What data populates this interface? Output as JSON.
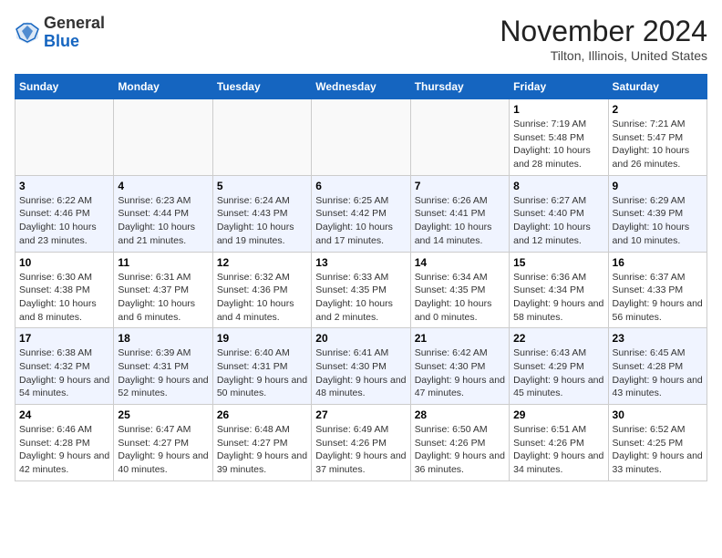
{
  "logo": {
    "general": "General",
    "blue": "Blue"
  },
  "header": {
    "month": "November 2024",
    "location": "Tilton, Illinois, United States"
  },
  "weekdays": [
    "Sunday",
    "Monday",
    "Tuesday",
    "Wednesday",
    "Thursday",
    "Friday",
    "Saturday"
  ],
  "weeks": [
    [
      {
        "day": "",
        "info": ""
      },
      {
        "day": "",
        "info": ""
      },
      {
        "day": "",
        "info": ""
      },
      {
        "day": "",
        "info": ""
      },
      {
        "day": "",
        "info": ""
      },
      {
        "day": "1",
        "info": "Sunrise: 7:19 AM\nSunset: 5:48 PM\nDaylight: 10 hours and 28 minutes."
      },
      {
        "day": "2",
        "info": "Sunrise: 7:21 AM\nSunset: 5:47 PM\nDaylight: 10 hours and 26 minutes."
      }
    ],
    [
      {
        "day": "3",
        "info": "Sunrise: 6:22 AM\nSunset: 4:46 PM\nDaylight: 10 hours and 23 minutes."
      },
      {
        "day": "4",
        "info": "Sunrise: 6:23 AM\nSunset: 4:44 PM\nDaylight: 10 hours and 21 minutes."
      },
      {
        "day": "5",
        "info": "Sunrise: 6:24 AM\nSunset: 4:43 PM\nDaylight: 10 hours and 19 minutes."
      },
      {
        "day": "6",
        "info": "Sunrise: 6:25 AM\nSunset: 4:42 PM\nDaylight: 10 hours and 17 minutes."
      },
      {
        "day": "7",
        "info": "Sunrise: 6:26 AM\nSunset: 4:41 PM\nDaylight: 10 hours and 14 minutes."
      },
      {
        "day": "8",
        "info": "Sunrise: 6:27 AM\nSunset: 4:40 PM\nDaylight: 10 hours and 12 minutes."
      },
      {
        "day": "9",
        "info": "Sunrise: 6:29 AM\nSunset: 4:39 PM\nDaylight: 10 hours and 10 minutes."
      }
    ],
    [
      {
        "day": "10",
        "info": "Sunrise: 6:30 AM\nSunset: 4:38 PM\nDaylight: 10 hours and 8 minutes."
      },
      {
        "day": "11",
        "info": "Sunrise: 6:31 AM\nSunset: 4:37 PM\nDaylight: 10 hours and 6 minutes."
      },
      {
        "day": "12",
        "info": "Sunrise: 6:32 AM\nSunset: 4:36 PM\nDaylight: 10 hours and 4 minutes."
      },
      {
        "day": "13",
        "info": "Sunrise: 6:33 AM\nSunset: 4:35 PM\nDaylight: 10 hours and 2 minutes."
      },
      {
        "day": "14",
        "info": "Sunrise: 6:34 AM\nSunset: 4:35 PM\nDaylight: 10 hours and 0 minutes."
      },
      {
        "day": "15",
        "info": "Sunrise: 6:36 AM\nSunset: 4:34 PM\nDaylight: 9 hours and 58 minutes."
      },
      {
        "day": "16",
        "info": "Sunrise: 6:37 AM\nSunset: 4:33 PM\nDaylight: 9 hours and 56 minutes."
      }
    ],
    [
      {
        "day": "17",
        "info": "Sunrise: 6:38 AM\nSunset: 4:32 PM\nDaylight: 9 hours and 54 minutes."
      },
      {
        "day": "18",
        "info": "Sunrise: 6:39 AM\nSunset: 4:31 PM\nDaylight: 9 hours and 52 minutes."
      },
      {
        "day": "19",
        "info": "Sunrise: 6:40 AM\nSunset: 4:31 PM\nDaylight: 9 hours and 50 minutes."
      },
      {
        "day": "20",
        "info": "Sunrise: 6:41 AM\nSunset: 4:30 PM\nDaylight: 9 hours and 48 minutes."
      },
      {
        "day": "21",
        "info": "Sunrise: 6:42 AM\nSunset: 4:30 PM\nDaylight: 9 hours and 47 minutes."
      },
      {
        "day": "22",
        "info": "Sunrise: 6:43 AM\nSunset: 4:29 PM\nDaylight: 9 hours and 45 minutes."
      },
      {
        "day": "23",
        "info": "Sunrise: 6:45 AM\nSunset: 4:28 PM\nDaylight: 9 hours and 43 minutes."
      }
    ],
    [
      {
        "day": "24",
        "info": "Sunrise: 6:46 AM\nSunset: 4:28 PM\nDaylight: 9 hours and 42 minutes."
      },
      {
        "day": "25",
        "info": "Sunrise: 6:47 AM\nSunset: 4:27 PM\nDaylight: 9 hours and 40 minutes."
      },
      {
        "day": "26",
        "info": "Sunrise: 6:48 AM\nSunset: 4:27 PM\nDaylight: 9 hours and 39 minutes."
      },
      {
        "day": "27",
        "info": "Sunrise: 6:49 AM\nSunset: 4:26 PM\nDaylight: 9 hours and 37 minutes."
      },
      {
        "day": "28",
        "info": "Sunrise: 6:50 AM\nSunset: 4:26 PM\nDaylight: 9 hours and 36 minutes."
      },
      {
        "day": "29",
        "info": "Sunrise: 6:51 AM\nSunset: 4:26 PM\nDaylight: 9 hours and 34 minutes."
      },
      {
        "day": "30",
        "info": "Sunrise: 6:52 AM\nSunset: 4:25 PM\nDaylight: 9 hours and 33 minutes."
      }
    ]
  ]
}
